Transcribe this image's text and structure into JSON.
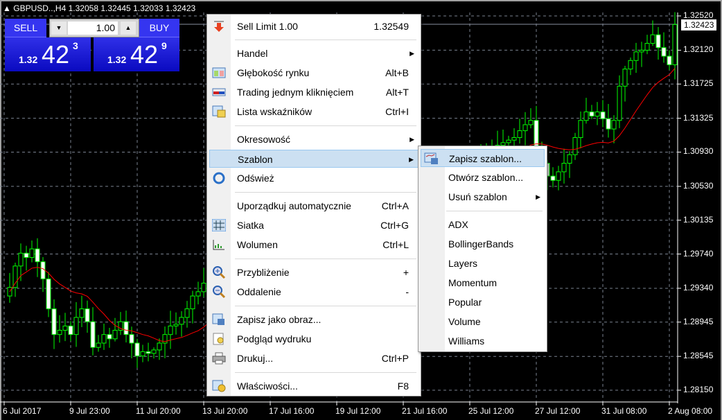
{
  "header": {
    "symbol": "GBPUSD..,H4",
    "open": "1.32058",
    "high": "1.32445",
    "low": "1.32033",
    "close": "1.32423"
  },
  "trade_panel": {
    "sell_label": "SELL",
    "buy_label": "BUY",
    "lot": "1.00",
    "sell_prefix": "1.32",
    "sell_big": "42",
    "sell_sup": "3",
    "buy_prefix": "1.32",
    "buy_big": "42",
    "buy_sup": "9"
  },
  "price_axis": [
    "1.32520",
    "1.32120",
    "1.31725",
    "1.31325",
    "1.30930",
    "1.30530",
    "1.30135",
    "1.29740",
    "1.29340",
    "1.28945",
    "1.28545",
    "1.28150"
  ],
  "current_price": "1.32423",
  "time_axis": [
    "6 Jul 2017",
    "9 Jul 23:00",
    "11 Jul 20:00",
    "13 Jul 20:00",
    "17 Jul 16:00",
    "19 Jul 12:00",
    "21 Jul 16:00",
    "25 Jul 12:00",
    "27 Jul 12:00",
    "31 Jul 08:00",
    "2 Aug 08:00"
  ],
  "colors": {
    "bull": "#00ff00",
    "bear": "#00ff00",
    "ma": "#ff0000",
    "grid": "#7a8290",
    "menu_highlight": "#cce0f2"
  },
  "chart_data": {
    "type": "candlestick",
    "price_range": [
      1.28,
      1.326
    ],
    "closes": [
      1.2925,
      1.2935,
      1.296,
      1.2975,
      1.297,
      1.298,
      1.2965,
      1.2945,
      1.291,
      1.288,
      1.2885,
      1.289,
      1.288,
      1.29,
      1.291,
      1.2895,
      1.2865,
      1.287,
      1.288,
      1.2875,
      1.2885,
      1.2895,
      1.288,
      1.287,
      1.2855,
      1.286,
      1.2858,
      1.2862,
      1.287,
      1.288,
      1.289,
      1.2892,
      1.29,
      1.291,
      1.2925,
      1.293,
      1.294,
      1.2945,
      null,
      null,
      null,
      null,
      null,
      null,
      null,
      null,
      null,
      null,
      null,
      null,
      null,
      null,
      null,
      null,
      null,
      null,
      null,
      null,
      null,
      null,
      null,
      null,
      null,
      null,
      null,
      null,
      null,
      null,
      null,
      null,
      null,
      null,
      null,
      null,
      null,
      null,
      null,
      null,
      null,
      null,
      null,
      null,
      null,
      null,
      null,
      null,
      null,
      null,
      null,
      null,
      null,
      null,
      1.311,
      1.3118,
      1.3125,
      1.313,
      1.31,
      1.308,
      1.3065,
      1.306,
      1.307,
      1.308,
      1.309,
      1.311,
      1.313,
      1.314,
      1.3135,
      1.314,
      1.3132,
      1.312,
      1.313,
      1.317,
      1.319,
      1.32,
      1.321,
      1.3212,
      1.322,
      1.323,
      1.3215,
      1.3205,
      1.3195,
      1.3242
    ]
  },
  "menu": {
    "items": [
      {
        "label": "Sell Limit 1.00",
        "shortcut": "1.32549",
        "icon": "sell-limit-arrow-icon"
      },
      {
        "label": "Handel",
        "submenu": true
      },
      {
        "label": "Głębokość rynku",
        "shortcut": "Alt+B",
        "icon": "market-depth-icon"
      },
      {
        "label": "Trading jednym kliknięciem",
        "shortcut": "Alt+T",
        "icon": "one-click-trading-icon"
      },
      {
        "label": "Lista wskaźników",
        "shortcut": "Ctrl+I",
        "icon": "indicators-list-icon"
      },
      {
        "label": "Okresowość",
        "submenu": true
      },
      {
        "label": "Szablon",
        "submenu": true
      },
      {
        "label": "Odśwież",
        "icon": "refresh-icon"
      },
      {
        "label": "Uporządkuj automatycznie",
        "shortcut": "Ctrl+A"
      },
      {
        "label": "Siatka",
        "shortcut": "Ctrl+G",
        "icon": "grid-icon"
      },
      {
        "label": "Wolumen",
        "shortcut": "Ctrl+L",
        "icon": "volume-icon"
      },
      {
        "label": "Przybliżenie",
        "shortcut": "+",
        "icon": "zoom-in-icon"
      },
      {
        "label": "Oddalenie",
        "shortcut": "-",
        "icon": "zoom-out-icon"
      },
      {
        "label": "Zapisz jako obraz...",
        "icon": "save-image-icon"
      },
      {
        "label": "Podgląd wydruku",
        "icon": "print-preview-icon"
      },
      {
        "label": "Drukuj...",
        "shortcut": "Ctrl+P",
        "icon": "print-icon"
      },
      {
        "label": "Właściwości...",
        "shortcut": "F8",
        "icon": "properties-icon"
      }
    ]
  },
  "submenu": {
    "items": [
      {
        "label": "Zapisz szablon...",
        "icon": "save-template-icon"
      },
      {
        "label": "Otwórz szablon..."
      },
      {
        "label": "Usuń szablon",
        "submenu": true
      },
      {
        "label": "ADX"
      },
      {
        "label": "BollingerBands"
      },
      {
        "label": "Layers"
      },
      {
        "label": "Momentum"
      },
      {
        "label": "Popular"
      },
      {
        "label": "Volume"
      },
      {
        "label": "Williams"
      }
    ]
  }
}
